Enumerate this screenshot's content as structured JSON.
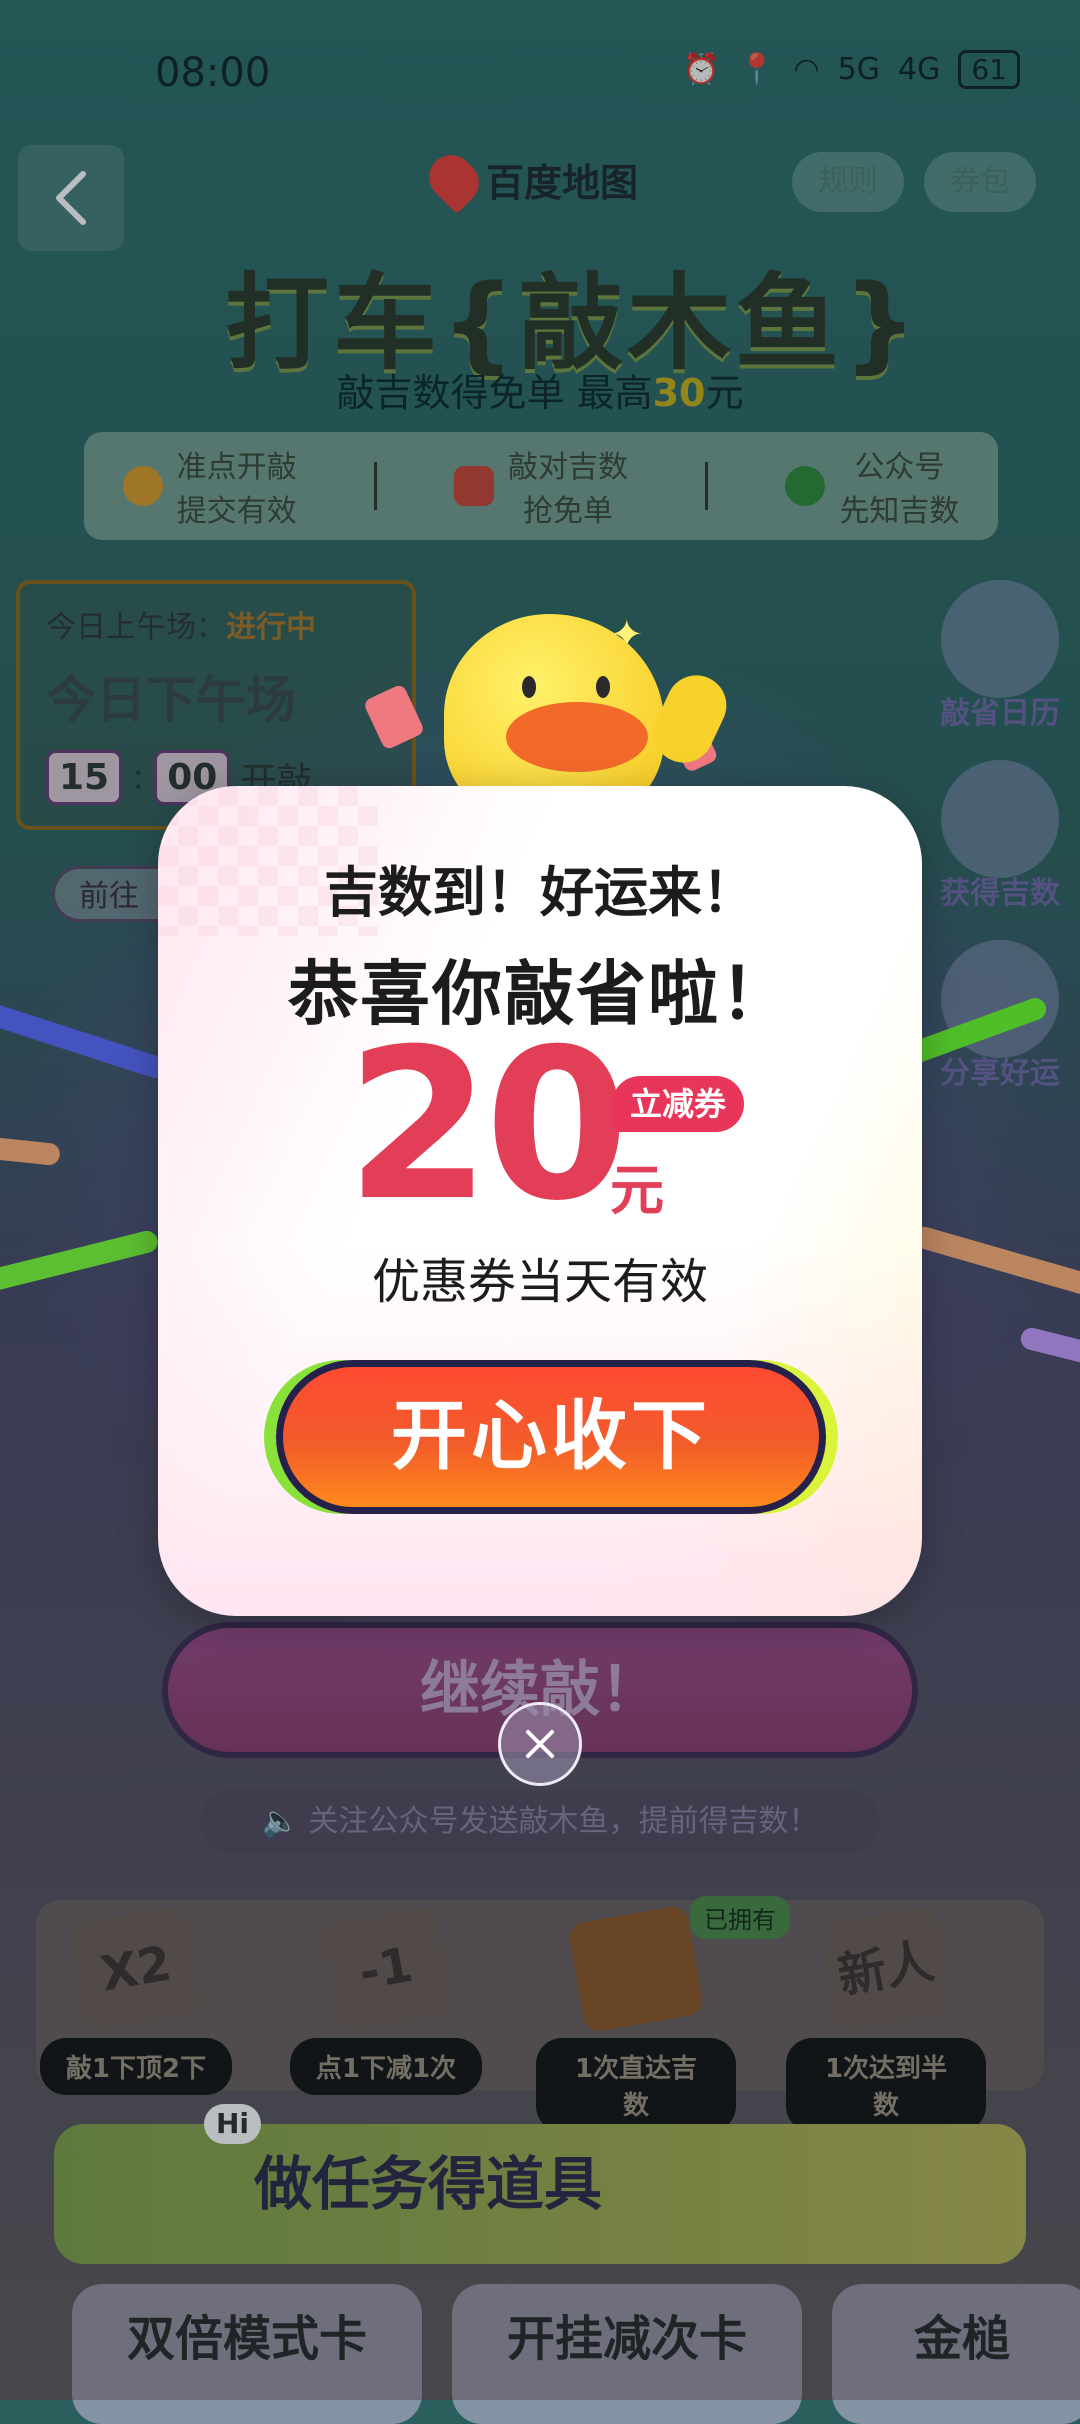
{
  "status_bar": {
    "time": "08:00",
    "icons": [
      "alarm-icon",
      "location-icon",
      "wifi-icon",
      "5g-signal-icon",
      "4g-signal-icon"
    ],
    "network_5g": "5G",
    "network_4g": "4G",
    "battery": "61"
  },
  "header": {
    "logo_text": "百度地图",
    "rules_label": "规则",
    "coupon_bag_label": "券包"
  },
  "hero": {
    "title": "打车{敲木鱼}",
    "subtitle_prefix": "敲吉数得免单 最高",
    "subtitle_highlight": "30",
    "subtitle_suffix": "元"
  },
  "info_strip": [
    {
      "line1": "准点开敲",
      "line2": "提交有效",
      "icon": "clock-icon"
    },
    {
      "line1": "敲对吉数",
      "line2": "抢免单",
      "icon": "free-ticket-icon"
    },
    {
      "line1": "公众号",
      "line2": "先知吉数",
      "icon": "check-badge-icon"
    }
  ],
  "session": {
    "morning_label": "今日上午场：",
    "morning_status": "进行中",
    "afternoon_title": "今日下午场",
    "hour": "15",
    "minute": "00",
    "start_label": "开敲",
    "goto_label": "前往"
  },
  "side_buttons": [
    {
      "label": "敲省日历",
      "icon": "calendar-icon"
    },
    {
      "label": "获得吉数",
      "icon": "scroll-icon"
    },
    {
      "label": "分享好运",
      "icon": "share-star-icon"
    }
  ],
  "continue_button": "继续敲！",
  "notice": "关注公众号发送敲木鱼，提前得吉数！",
  "props": {
    "owned_badge": "已拥有",
    "items": [
      {
        "card": "X2",
        "label": "敲1下顶2下"
      },
      {
        "card": "-1",
        "label": "点1下减1次"
      },
      {
        "card": "",
        "label": "1次直达吉数"
      },
      {
        "card": "新人",
        "label": "1次达到半数"
      }
    ]
  },
  "tasks": {
    "banner_hi": "Hi",
    "banner_title": "做任务得道具",
    "cards": [
      "双倍模式卡",
      "开挂减次卡",
      "金槌"
    ]
  },
  "modal": {
    "headline": "吉数到！好运来！",
    "congrats": "恭喜你敲省啦！",
    "amount": "20",
    "coupon_tag": "立减券",
    "unit": "元",
    "validity": "优惠券当天有效",
    "accept_button": "开心收下"
  }
}
